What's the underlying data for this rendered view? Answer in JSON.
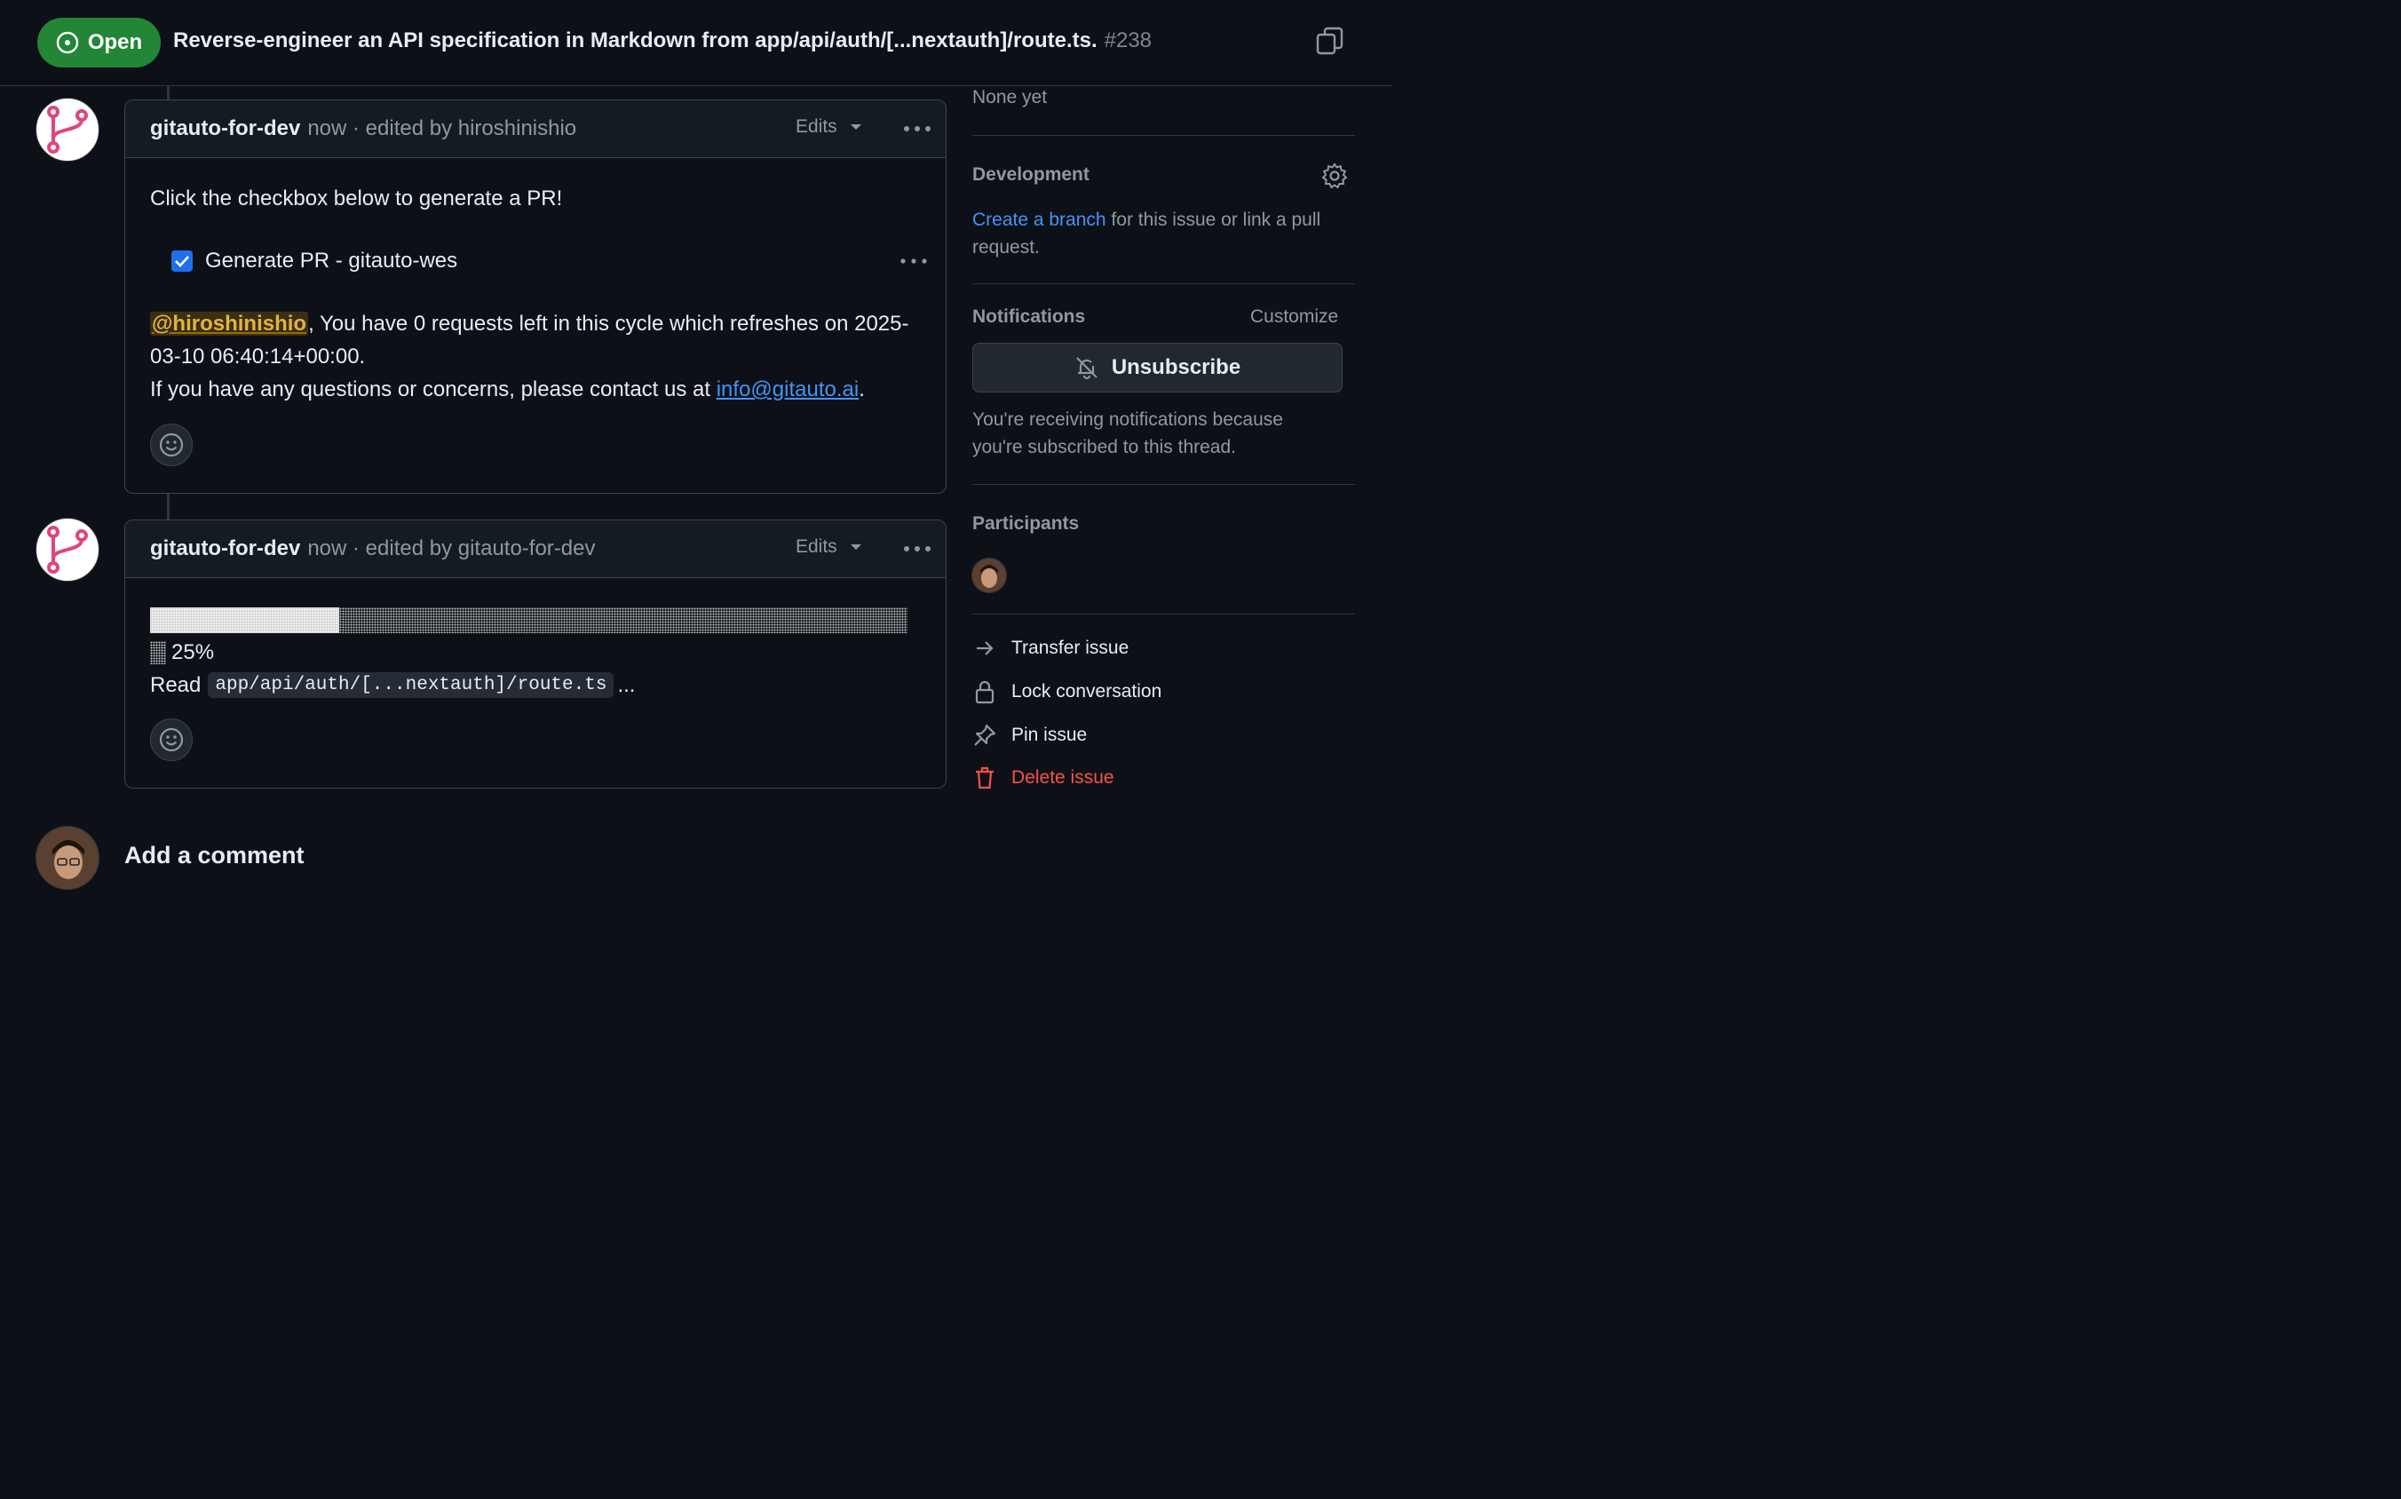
{
  "issue": {
    "state": "Open",
    "title": "Reverse-engineer an API specification in Markdown from app/api/auth/[...nextauth]/route.ts.",
    "number": "#238"
  },
  "comments": [
    {
      "author": "gitauto-for-dev",
      "meta": "now · edited by hiroshinishio",
      "edits_label": "Edits",
      "intro": "Click the checkbox below to generate a PR!",
      "task_label": "Generate PR - gitauto-wes",
      "task_checked": true,
      "mention": "@hiroshinishio",
      "message_1": ", You have 0 requests left in this cycle which refreshes on 2025-03-10 06:40:14+00:00.",
      "message_2": "If you have any questions or concerns, please contact us at ",
      "contact_link": "info@gitauto.ai",
      "message_end": "."
    },
    {
      "author": "gitauto-for-dev",
      "meta": "now · edited by gitauto-for-dev",
      "edits_label": "Edits",
      "progress_fraction": 0.25,
      "progress_text": "25%",
      "read_prefix": "Read",
      "read_path": "app/api/auth/[...nextauth]/route.ts",
      "read_suffix": "..."
    }
  ],
  "sidebar": {
    "milestone_value": "None yet",
    "development": {
      "heading": "Development",
      "link": "Create a branch",
      "text": " for this issue or link a pull request."
    },
    "notifications": {
      "heading": "Notifications",
      "customize": "Customize",
      "button": "Unsubscribe",
      "reason": "You're receiving notifications because you're subscribed to this thread."
    },
    "participants_heading": "Participants",
    "actions": [
      {
        "label": "Transfer issue",
        "icon": "arrow-right-icon"
      },
      {
        "label": "Lock conversation",
        "icon": "lock-icon"
      },
      {
        "label": "Pin issue",
        "icon": "pin-icon"
      },
      {
        "label": "Delete issue",
        "icon": "trash-icon",
        "color": "#f85149"
      }
    ]
  },
  "composer": {
    "heading": "Add a comment"
  },
  "colors": {
    "open_badge": "#238636",
    "link": "#4493f8",
    "danger": "#f85149",
    "mention": "#e3b341",
    "bot_avatar": "#e0457b"
  }
}
